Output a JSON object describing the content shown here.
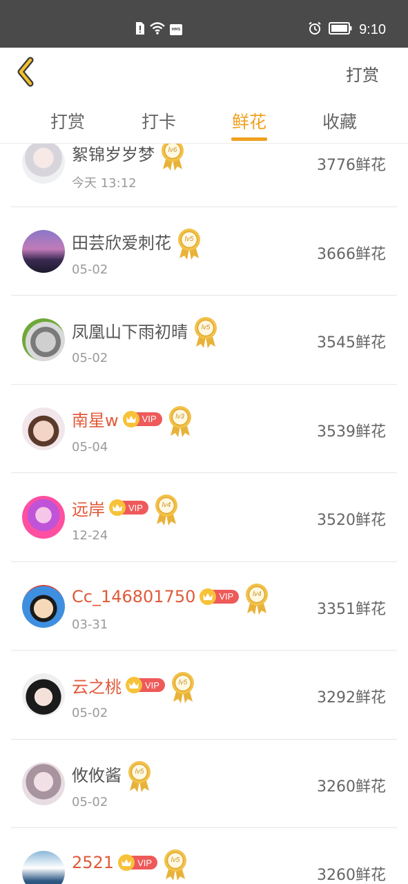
{
  "status_bar": {
    "time": "9:10",
    "hms_label": "HMS"
  },
  "header": {
    "right_action": "打赏"
  },
  "tabs": [
    {
      "label": "打赏",
      "active": false
    },
    {
      "label": "打卡",
      "active": false
    },
    {
      "label": "鲜花",
      "active": true
    },
    {
      "label": "收藏",
      "active": false
    }
  ],
  "colors": {
    "accent": "#f0a020",
    "vip_name": "#e05a3a",
    "vip_badge": "#ee5a5a"
  },
  "rows": [
    {
      "name": "絮锦岁岁梦",
      "vip": false,
      "level": "lv6",
      "date": "今天 13:12",
      "flowers": "3776鲜花",
      "avatar": "avatar-1"
    },
    {
      "name": "田芸欣爱刺花",
      "vip": false,
      "level": "lv5",
      "date": "05-02",
      "flowers": "3666鲜花",
      "avatar": "avatar-2"
    },
    {
      "name": "凤凰山下雨初晴",
      "vip": false,
      "level": "lv5",
      "date": "05-02",
      "flowers": "3545鲜花",
      "avatar": "avatar-3"
    },
    {
      "name": "南星w",
      "vip": true,
      "vip_label": "VIP",
      "level": "lv3",
      "date": "05-04",
      "flowers": "3539鲜花",
      "avatar": "avatar-4"
    },
    {
      "name": "远岸",
      "vip": true,
      "vip_label": "VIP",
      "level": "lv4",
      "date": "12-24",
      "flowers": "3520鲜花",
      "avatar": "avatar-5"
    },
    {
      "name": "Cc_146801750",
      "vip": true,
      "vip_label": "VIP",
      "level": "lv4",
      "date": "03-31",
      "flowers": "3351鲜花",
      "avatar": "avatar-6"
    },
    {
      "name": "云之桃",
      "vip": true,
      "vip_label": "VIP",
      "level": "lv5",
      "date": "05-02",
      "flowers": "3292鲜花",
      "avatar": "avatar-7"
    },
    {
      "name": "攸攸酱",
      "vip": false,
      "level": "lv5",
      "date": "05-02",
      "flowers": "3260鲜花",
      "avatar": "avatar-8"
    },
    {
      "name": "2521",
      "vip": true,
      "vip_label": "VIP",
      "level": "lv5",
      "date": "",
      "flowers": "3260鲜花",
      "avatar": "avatar-9"
    }
  ]
}
